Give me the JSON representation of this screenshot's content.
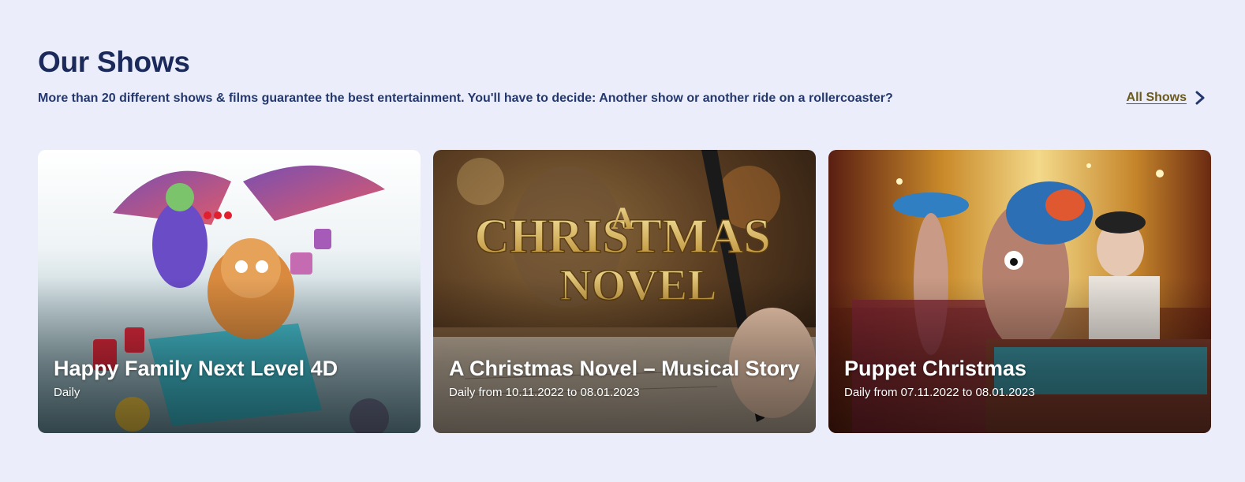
{
  "section": {
    "title": "Our Shows",
    "subtitle": "More than 20 different shows & films guarantee the best entertainment. You'll have to decide: Another show or another ride on a rollercoaster?",
    "all_shows_label": "All Shows"
  },
  "cards": [
    {
      "title": "Happy Family Next Level 4D",
      "schedule": "Daily",
      "image": "animated-monster-family-poster"
    },
    {
      "title": "A Christmas Novel – Musical Story",
      "schedule": "Daily from 10.11.2022 to 08.01.2023",
      "image": "christmas-novel-writing-hand"
    },
    {
      "title": "Puppet Christmas",
      "schedule": "Daily from 07.11.2022 to 08.01.2023",
      "image": "puppets-golden-curtain"
    }
  ],
  "colors": {
    "background": "#ebeefa",
    "title": "#1b2a5a",
    "link": "#6b5a1e"
  },
  "icons": {
    "all_shows": "chevron-right-icon"
  }
}
